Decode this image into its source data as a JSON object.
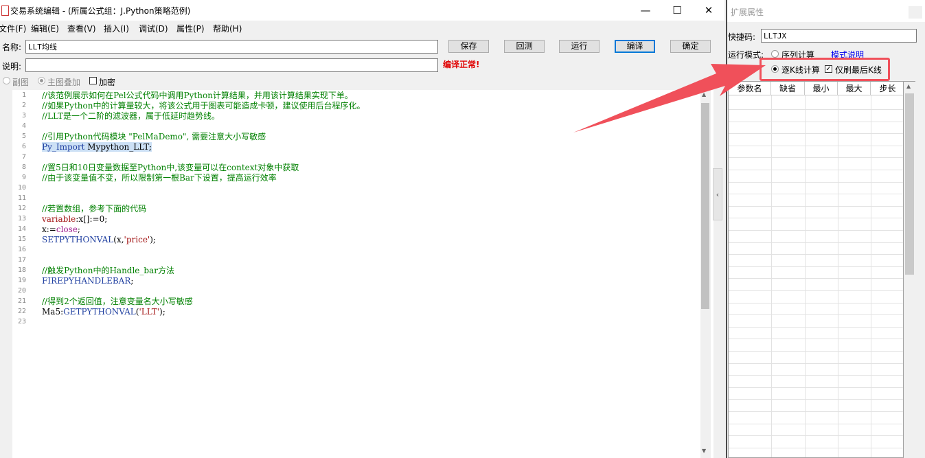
{
  "window": {
    "title": "交易系统编辑 - (所属公式组：J.Python策略范例)",
    "minimize": "—",
    "maximize": "☐",
    "close": "✕"
  },
  "menu": [
    {
      "label": "文件(F)"
    },
    {
      "label": "编辑(E)"
    },
    {
      "label": "查看(V)"
    },
    {
      "label": "插入(I)"
    },
    {
      "label": "调试(D)"
    },
    {
      "label": "属性(P)"
    },
    {
      "label": "帮助(H)"
    }
  ],
  "form": {
    "name_label": "名称:",
    "name_value": "LLT均线",
    "desc_label": "说明:",
    "desc_value": "",
    "status": "编译正常!",
    "status_color": "#e00000",
    "buttons": {
      "save": "保存",
      "backtest": "回测",
      "run": "运行",
      "compile": "编译",
      "ok": "确定"
    },
    "option_sub": "副图",
    "option_main": "主图叠加",
    "option_encrypt": "加密"
  },
  "code": {
    "line_numbers": [
      "1",
      "2",
      "3",
      "4",
      "5",
      "6",
      "7",
      "8",
      "9",
      "10",
      "11",
      "12",
      "13",
      "14",
      "15",
      "16",
      "17",
      "18",
      "19",
      "20",
      "21",
      "22",
      "23"
    ],
    "l1": "//该范例展示如何在Pel公式代码中调用Python计算结果，并用该计算结果实现下单。",
    "l2": "//如果Python中的计算量较大，将该公式用于图表可能造成卡顿，建议使用后台程序化。",
    "l3": "//LLT是一个二阶的滤波器，属于低延时趋势线。",
    "l5": "//引用Python代码模块 \"PelMaDemo\", 需要注意大小写敏感",
    "l6_fn": "Py_Import",
    "l6_arg": " Mypython_LLT;",
    "l8": "//置5日和10日变量数据至Python中,该变量可以在context对象中获取",
    "l9": "//由于该变量值不变，所以限制第一根Bar下设置，提高运行效率",
    "l12": "//若置数组，参考下面的代码",
    "l13_kw": "variable",
    "l13_rest": ":x[]:=0;",
    "l14_a": "x:=",
    "l14_kw": "close",
    "l14_b": ";",
    "l15_fn": "SETPYTHONVAL",
    "l15_a": "(x,",
    "l15_str": "'price'",
    "l15_b": ");",
    "l18": "//触发Python中的Handle_bar方法",
    "l19_fn": "FIREPYHANDLEBAR",
    "l19_b": ";",
    "l21": "//得到2个返回值，注意变量名大小写敏感",
    "l22_a": "Ma5:",
    "l22_fn": "GETPYTHONVAL",
    "l22_b": "(",
    "l22_str": "'LLT'",
    "l22_c": ");"
  },
  "panel": {
    "title": "扩展属性",
    "shortcut_label": "快捷码:",
    "shortcut_value": "LLTJX",
    "mode_label": "运行模式:",
    "mode_sequence": "序列计算",
    "mode_help": "模式说明",
    "mode_tick": "逐K线计算",
    "refresh_last": "仅刷最后K线",
    "columns": [
      "参数名",
      "缺省",
      "最小",
      "最大",
      "步长"
    ]
  },
  "accent": {
    "annotation": "#f0505a",
    "link": "#0000ee"
  }
}
